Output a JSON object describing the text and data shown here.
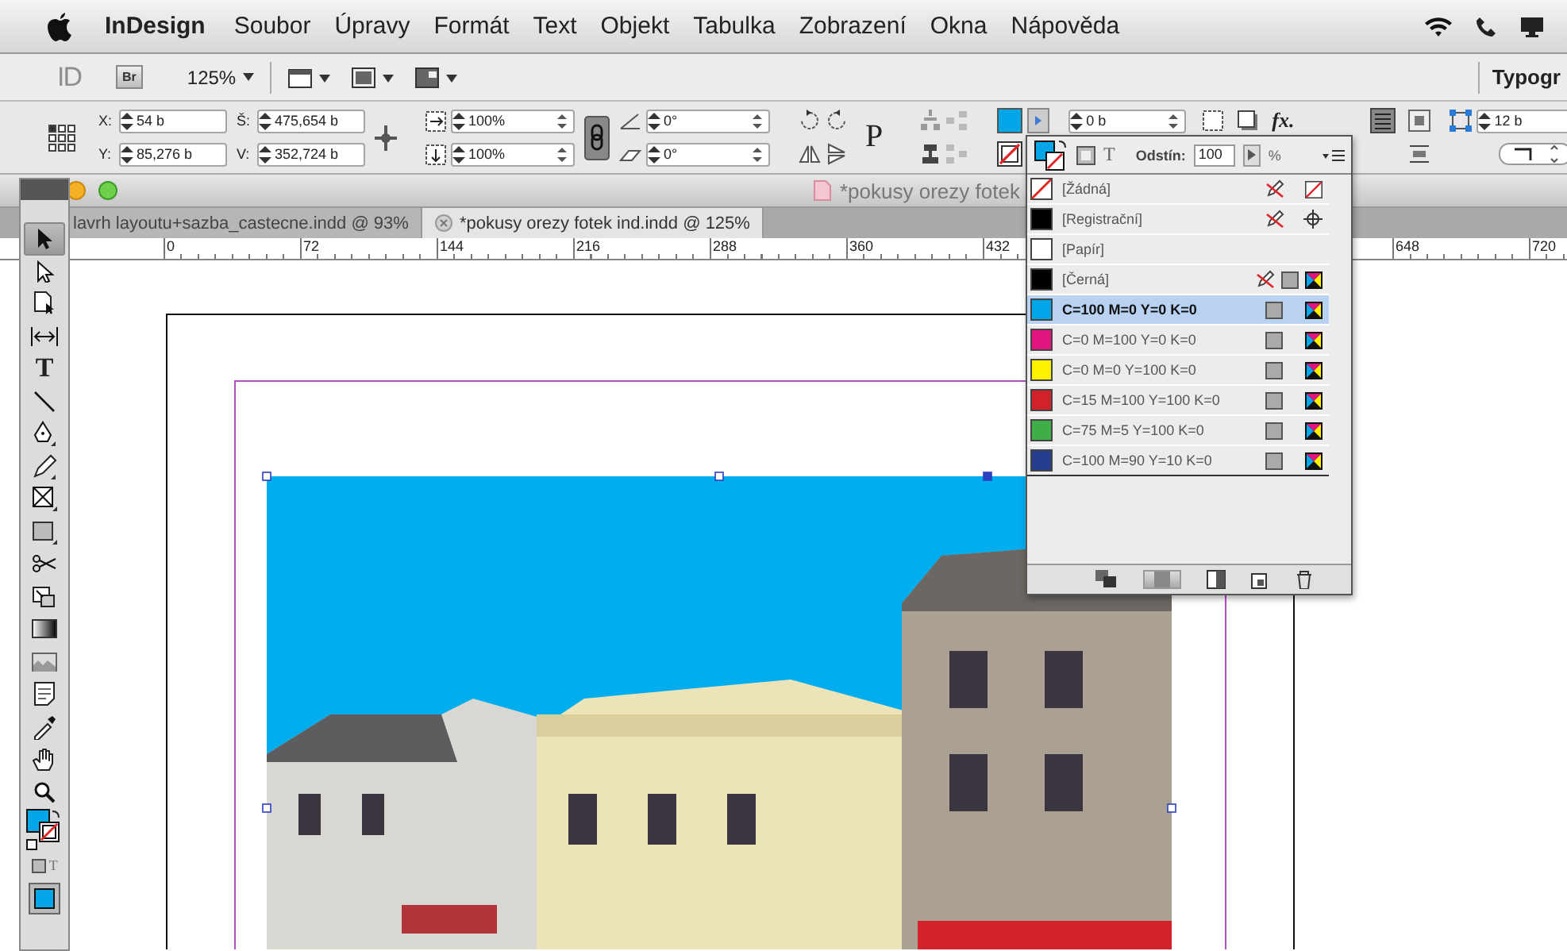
{
  "menu_bar": {
    "app_name": "InDesign",
    "menus": [
      "Soubor",
      "Úpravy",
      "Formát",
      "Text",
      "Objekt",
      "Tabulka",
      "Zobrazení",
      "Okna",
      "Nápověda"
    ]
  },
  "app_bar": {
    "logo": "ID",
    "bridge_button": "Br",
    "zoom": "125%",
    "workspace": "Typogr"
  },
  "control_panel": {
    "position_fields": [
      {
        "label": "X:",
        "value": "54 b"
      },
      {
        "label": "Y:",
        "value": "85,276 b"
      }
    ],
    "size_fields": [
      {
        "label": "Š:",
        "value": "475,654 b"
      },
      {
        "label": "V:",
        "value": "352,724 b"
      }
    ],
    "scale_fields": [
      "100%",
      "100%"
    ],
    "angle_fields": [
      "0°",
      "0°"
    ],
    "frame_label": "P",
    "stroke_weight": "0 b",
    "effects_label": "fx.",
    "corner_size": "12 b"
  },
  "window": {
    "title": "*pokusy orezy fotek"
  },
  "tabs": [
    {
      "label": "lavrh layoutu+sazba_castecne.indd @ 93%",
      "selected": false
    },
    {
      "label": "*pokusy orezy fotek ind.indd @ 125%",
      "selected": true
    }
  ],
  "ruler": {
    "left_labels": [
      "0",
      "72",
      "144",
      "216",
      "288",
      "360",
      "432"
    ],
    "right_labels": [
      "648",
      "720"
    ]
  },
  "tools": [
    {
      "kind": "selection",
      "selected": true
    },
    {
      "kind": "direct",
      "selected": false
    },
    {
      "kind": "page",
      "selected": false
    },
    {
      "kind": "gap",
      "selected": false
    },
    {
      "kind": "type",
      "glyph": "T",
      "selected": false
    },
    {
      "kind": "line",
      "selected": false
    },
    {
      "kind": "pen",
      "selected": false
    },
    {
      "kind": "pencil",
      "selected": false
    },
    {
      "kind": "frame",
      "selected": false
    },
    {
      "kind": "rect",
      "selected": false
    },
    {
      "kind": "scissors",
      "selected": false
    },
    {
      "kind": "transform",
      "selected": false
    },
    {
      "kind": "gradient",
      "selected": false
    },
    {
      "kind": "feather",
      "selected": false
    },
    {
      "kind": "note",
      "selected": false
    },
    {
      "kind": "eyedropper",
      "selected": false
    },
    {
      "kind": "hand",
      "selected": false
    },
    {
      "kind": "zoom",
      "selected": false
    },
    {
      "kind": "fillstroke",
      "selected": false
    },
    {
      "kind": "format",
      "glyph": "T",
      "selected": false
    },
    {
      "kind": "view",
      "selected": false
    }
  ],
  "swatches_panel": {
    "tint_label": "Odstín:",
    "tint": "100",
    "unit": "%",
    "text_glyph": "T",
    "swatches": [
      {
        "name": "[Žádná]",
        "kind": "none",
        "selected": false,
        "locked": true
      },
      {
        "name": "[Registrační]",
        "kind": "registration",
        "color": "#000000",
        "selected": false,
        "locked": true
      },
      {
        "name": "[Papír]",
        "kind": "paper",
        "color": "#ffffff",
        "selected": false,
        "locked": false
      },
      {
        "name": "[Černá]",
        "kind": "process",
        "color": "#000000",
        "selected": false,
        "locked": true
      },
      {
        "name": "C=100 M=0 Y=0 K=0",
        "kind": "process",
        "color": "#00a6e8",
        "selected": true,
        "locked": false
      },
      {
        "name": "C=0 M=100 Y=0 K=0",
        "kind": "process",
        "color": "#e0157f",
        "selected": false,
        "locked": false
      },
      {
        "name": "C=0 M=0 Y=100 K=0",
        "kind": "process",
        "color": "#fff200",
        "selected": false,
        "locked": false
      },
      {
        "name": "C=15 M=100 Y=100 K=0",
        "kind": "process",
        "color": "#d2232a",
        "selected": false,
        "locked": false
      },
      {
        "name": "C=75 M=5 Y=100 K=0",
        "kind": "process",
        "color": "#3fae49",
        "selected": false,
        "locked": false
      },
      {
        "name": "C=100 M=90 Y=10 K=0",
        "kind": "process",
        "color": "#263d8f",
        "selected": false,
        "locked": false
      }
    ]
  }
}
